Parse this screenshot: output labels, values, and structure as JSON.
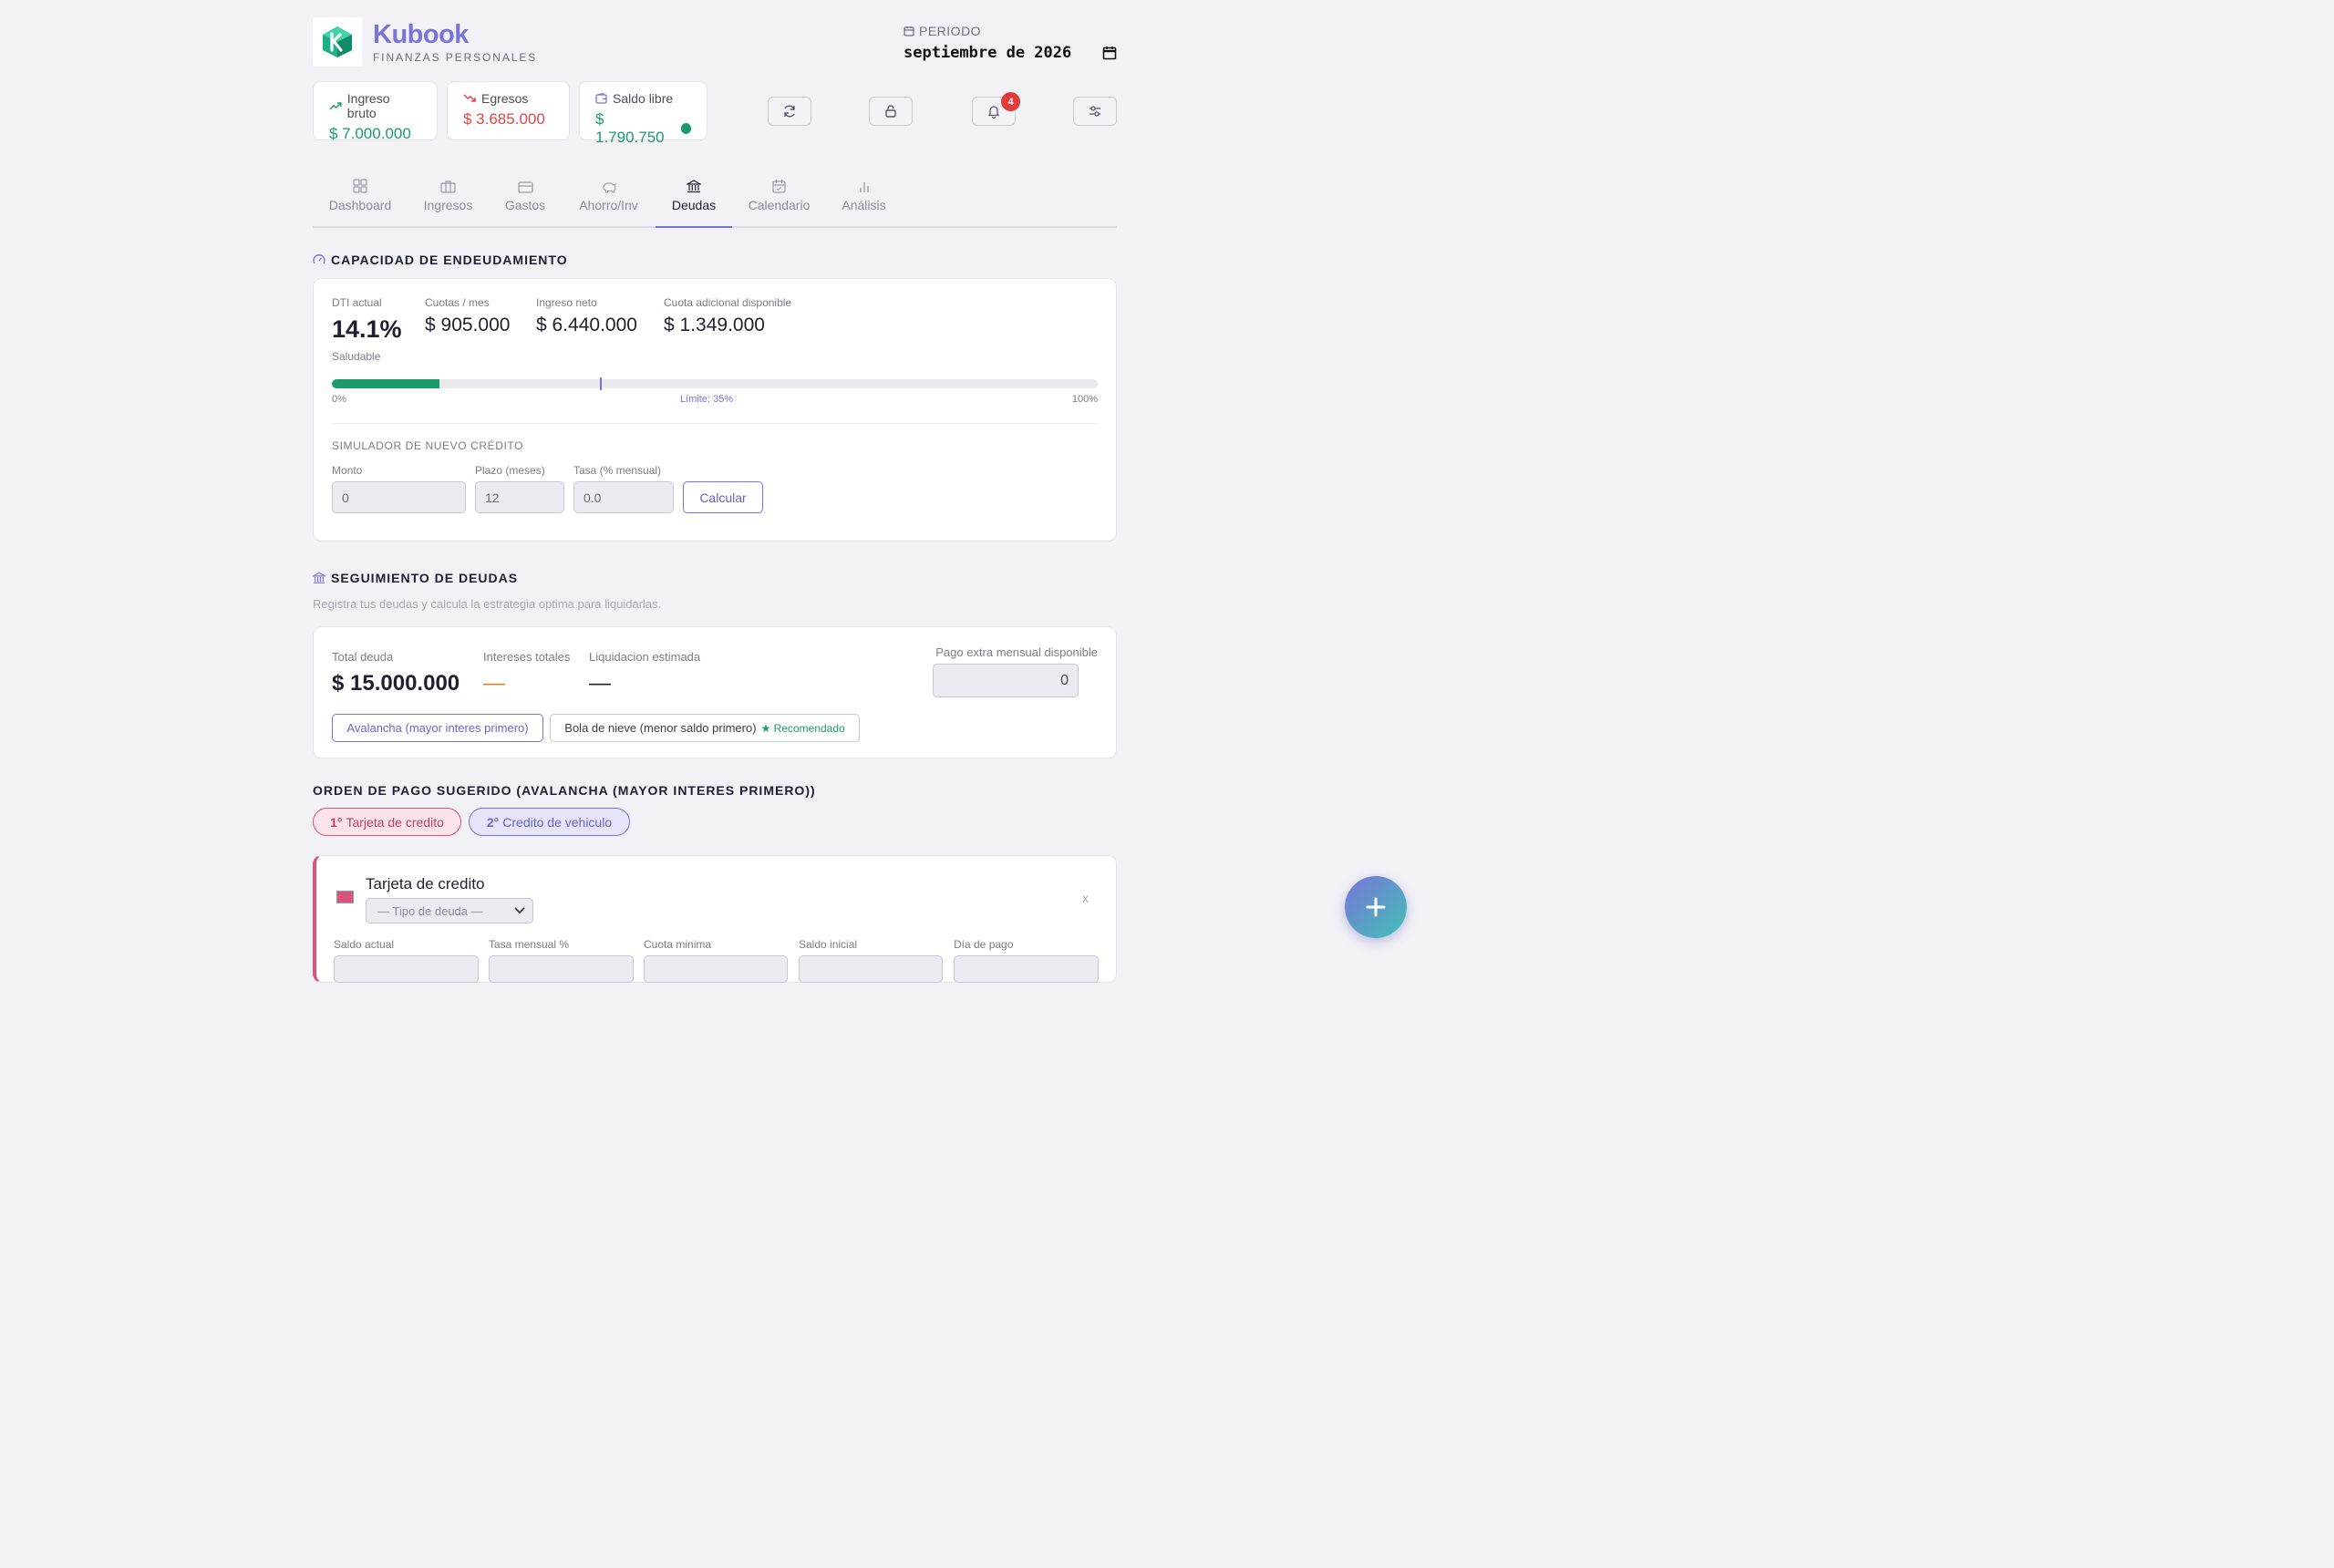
{
  "brand": {
    "name": "Kubook",
    "subtitle": "FINANZAS PERSONALES"
  },
  "period": {
    "label": "PERIODO",
    "value": "septiembre de 2026"
  },
  "summary": [
    {
      "label": "Ingreso bruto",
      "value": "$ 7.000.000",
      "icon": "trending-up-icon"
    },
    {
      "label": "Egresos",
      "value": "$ 3.685.000",
      "icon": "trending-down-icon"
    },
    {
      "label": "Saldo libre",
      "value": "$ 1.790.750",
      "icon": "wallet-icon"
    }
  ],
  "toolbar": {
    "notifications_count": "4"
  },
  "tabs": [
    {
      "label": "Dashboard",
      "icon": "grid-icon"
    },
    {
      "label": "Ingresos",
      "icon": "briefcase-icon"
    },
    {
      "label": "Gastos",
      "icon": "credit-card-icon"
    },
    {
      "label": "Ahorro/Inv",
      "icon": "piggy-bank-icon"
    },
    {
      "label": "Deudas",
      "icon": "bank-icon"
    },
    {
      "label": "Calendario",
      "icon": "calendar-icon"
    },
    {
      "label": "Análisis",
      "icon": "bar-chart-icon"
    }
  ],
  "active_tab": "Deudas",
  "capacity": {
    "title": "CAPACIDAD DE ENDEUDAMIENTO",
    "dti_label": "DTI actual",
    "dti_value": "14.1%",
    "dti_status": "Saludable",
    "dti_fraction": 0.141,
    "limit_fraction": 0.35,
    "cuotas_label": "Cuotas / mes",
    "cuotas_value": "$ 905.000",
    "ingreso_label": "Ingreso neto",
    "ingreso_value": "$ 6.440.000",
    "cuota_label": "Cuota adicional disponible",
    "cuota_value": "$ 1.349.000",
    "scale_min": "0%",
    "scale_limit": "Límite: 35%",
    "scale_max": "100%",
    "simulator": {
      "title": "SIMULADOR DE NUEVO CRÉDITO",
      "monto_label": "Monto",
      "monto_value": "0",
      "plazo_label": "Plazo (meses)",
      "plazo_value": "12",
      "tasa_label": "Tasa (% mensual)",
      "tasa_value": "0.0",
      "button": "Calcular"
    }
  },
  "tracking": {
    "title": "SEGUIMIENTO DE DEUDAS",
    "description": "Registra tus deudas y calcula la estrategia optima para liquidarlas.",
    "total_label": "Total deuda",
    "total_value": "$ 15.000.000",
    "interest_label": "Intereses totales",
    "interest_value": "—",
    "payoff_label": "Liquidacion estimada",
    "payoff_value": "—",
    "extra_label": "Pago extra mensual disponible",
    "extra_value": "0",
    "strategy_avalanche": "Avalancha (mayor interes primero)",
    "strategy_snowball": "Bola de nieve (menor saldo primero)",
    "recommended": "★ Recomendado"
  },
  "order": {
    "title": "ORDEN DE PAGO SUGERIDO (AVALANCHA (MAYOR INTERES PRIMERO))",
    "items": [
      {
        "rank": "1°",
        "name": "Tarjeta de credito"
      },
      {
        "rank": "2°",
        "name": "Credito de vehiculo"
      }
    ]
  },
  "debt_card": {
    "name": "Tarjeta de credito",
    "color": "#d6567e",
    "type_placeholder": "— Tipo de deuda —",
    "close": "x",
    "fields": [
      "Saldo actual",
      "Tasa mensual %",
      "Cuota minima",
      "Saldo inicial",
      "Día de pago"
    ]
  },
  "colors": {
    "accent": "#7a74d9",
    "positive": "#1d9a6c",
    "negative": "#e14848",
    "warning": "#d9822b"
  }
}
